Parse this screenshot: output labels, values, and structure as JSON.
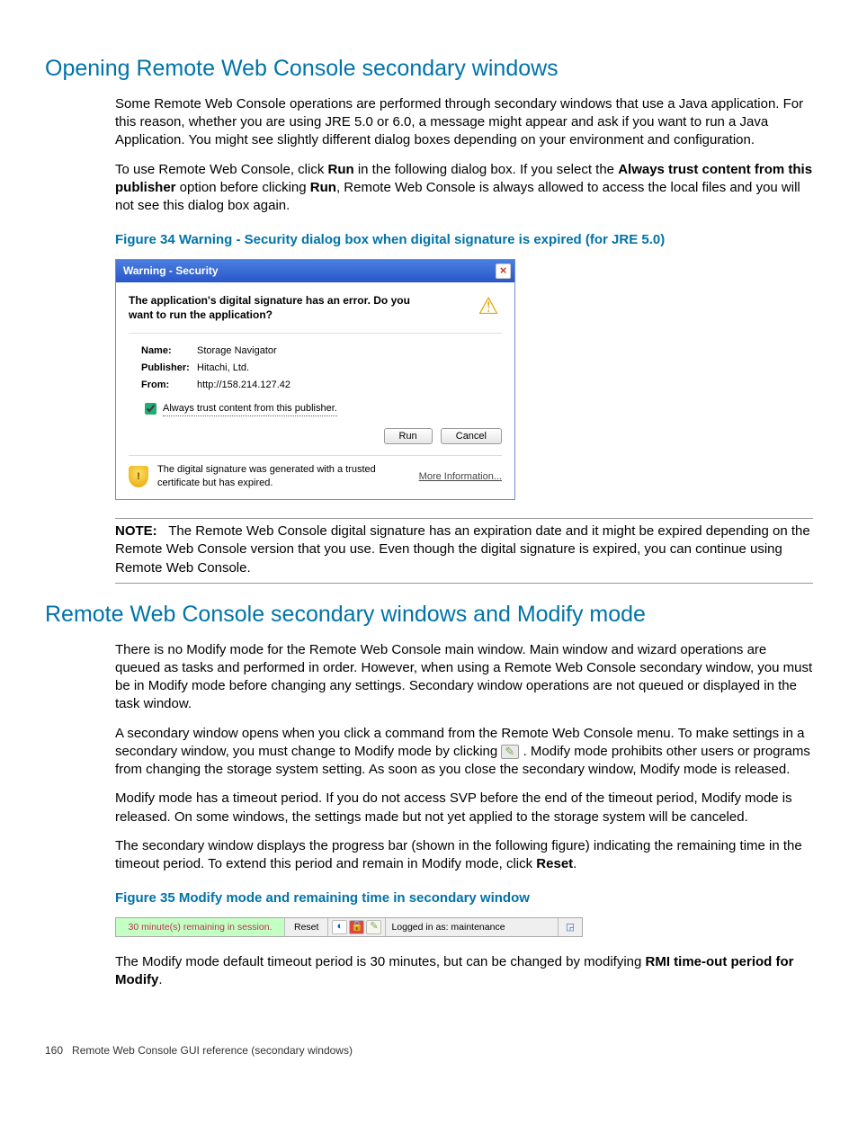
{
  "section1": {
    "heading": "Opening Remote Web Console secondary windows",
    "p1": "Some Remote Web Console operations are performed through secondary windows that use a Java application. For this reason, whether you are using JRE 5.0 or 6.0, a message might appear and ask if you want to run a Java Application. You might see slightly different dialog boxes depending on your environment and configuration.",
    "p2a": "To use Remote Web Console, click ",
    "p2b_bold": "Run",
    "p2c": " in the following dialog box. If you select the ",
    "p2d_bold": "Always trust content from this publisher",
    "p2e": " option before clicking ",
    "p2f_bold": "Run",
    "p2g": ", Remote Web Console is always allowed to access the local files and you will not see this dialog box again.",
    "fig34_caption": "Figure 34 Warning - Security dialog box when digital signature is expired (for JRE 5.0)"
  },
  "dialog": {
    "title": "Warning - Security",
    "message": "The application's digital signature has an error. Do you want to run the application?",
    "name_label": "Name:",
    "name_value": "Storage Navigator",
    "pub_label": "Publisher:",
    "pub_value": "Hitachi, Ltd.",
    "from_label": "From:",
    "from_value": "http://158.214.127.42",
    "trust_label": "Always trust content from this publisher.",
    "run": "Run",
    "cancel": "Cancel",
    "foot_msg": "The digital signature was generated with a trusted certificate but has expired.",
    "more": "More Information..."
  },
  "note": {
    "label": "NOTE:",
    "text": "The Remote Web Console digital signature has an expiration date and it might be expired depending on the Remote Web Console version that you use. Even though the digital signature is expired, you can continue using Remote Web Console."
  },
  "section2": {
    "heading": "Remote Web Console secondary windows and Modify mode",
    "p1": "There is no Modify mode for the Remote Web Console main window. Main window and wizard operations are queued as tasks and performed in order. However, when using a Remote Web Console secondary window, you must be in Modify mode before changing any settings. Secondary window operations are not queued or displayed in the task window.",
    "p2a": "A secondary window opens when you click a command from the Remote Web Console menu. To make settings in a secondary window, you must change to Modify mode by clicking ",
    "p2b": ". Modify mode prohibits other users or programs from changing the storage system setting. As soon as you close the secondary window, Modify mode is released.",
    "p3": "Modify mode has a timeout period. If you do not access SVP before the end of the timeout period, Modify mode is released. On some windows, the settings made but not yet applied to the storage system will be canceled.",
    "p4a": "The secondary window displays the progress bar (shown in the following figure) indicating the remaining time in the timeout period. To extend this period and remain in Modify mode, click ",
    "p4b_bold": "Reset",
    "p4c": ".",
    "fig35_caption": "Figure 35  Modify mode and remaining time in secondary window",
    "p5a": "The Modify mode default timeout period is 30 minutes, but can be changed by modifying ",
    "p5b_bold": "RMI time-out period for Modify",
    "p5c": "."
  },
  "statusbar": {
    "remaining": "30 minute(s) remaining in session.",
    "reset": "Reset",
    "logged_in": "Logged in as: maintenance"
  },
  "footer": {
    "page": "160",
    "title": "Remote Web Console GUI reference (secondary windows)"
  }
}
